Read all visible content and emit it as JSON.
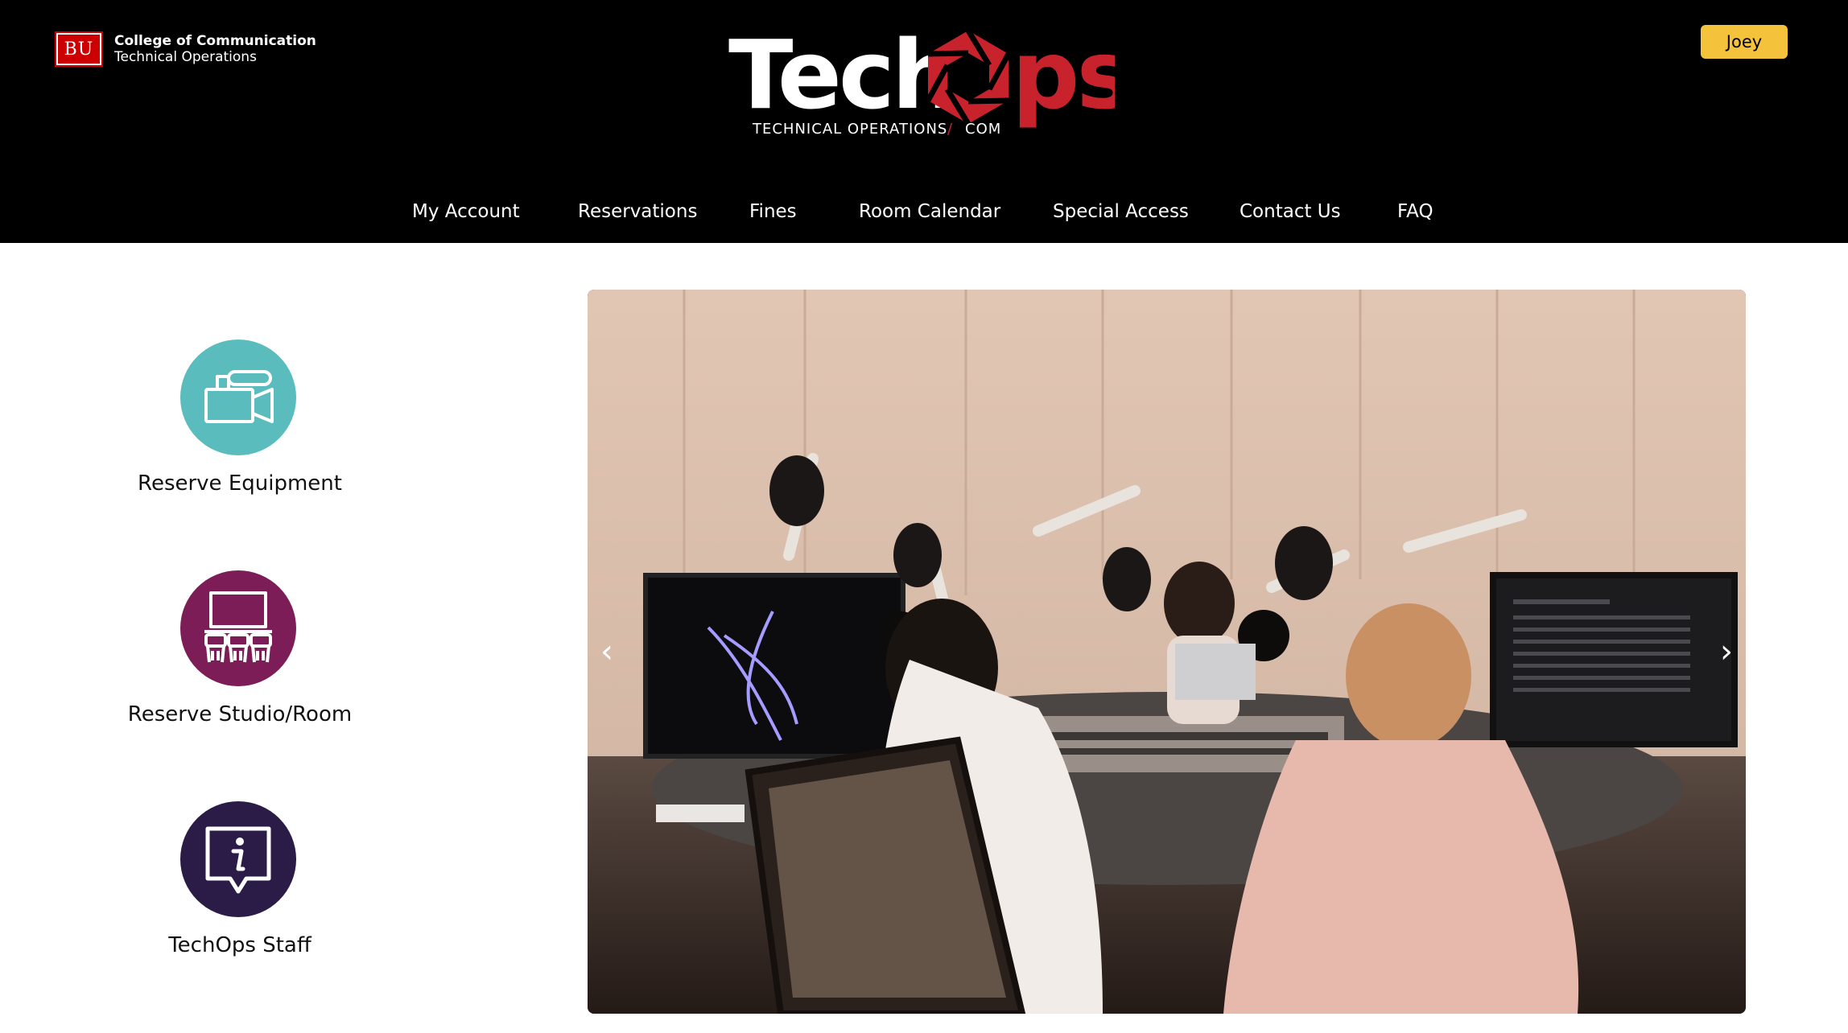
{
  "header": {
    "bu_badge": "BU",
    "college_name": "College of Communication",
    "college_sub": "Technical Operations",
    "logo": {
      "word_start": "Tech",
      "word_end": "ps",
      "tagline_left": "TECHNICAL OPERATIONS",
      "tagline_sep": "/",
      "tagline_right": "COM"
    },
    "user_button": "Joey"
  },
  "nav": {
    "items": [
      "My Account",
      "Reservations",
      "Fines",
      "Room Calendar",
      "Special Access",
      "Contact Us",
      "FAQ"
    ]
  },
  "sidebar": {
    "items": [
      {
        "label": "Reserve Equipment",
        "icon": "video-camera-icon",
        "color": "#5bbcbd"
      },
      {
        "label": "Reserve Studio/Room",
        "icon": "studio-room-icon",
        "color": "#7d1d57"
      },
      {
        "label": "TechOps Staff",
        "icon": "info-chat-icon",
        "color": "#2b1b47"
      }
    ]
  },
  "carousel": {
    "prev": "‹",
    "next": "›",
    "image": "radio-studio-photo"
  },
  "colors": {
    "header_bg": "#000000",
    "accent_red": "#c8232c",
    "button_yellow": "#f5c33b"
  }
}
